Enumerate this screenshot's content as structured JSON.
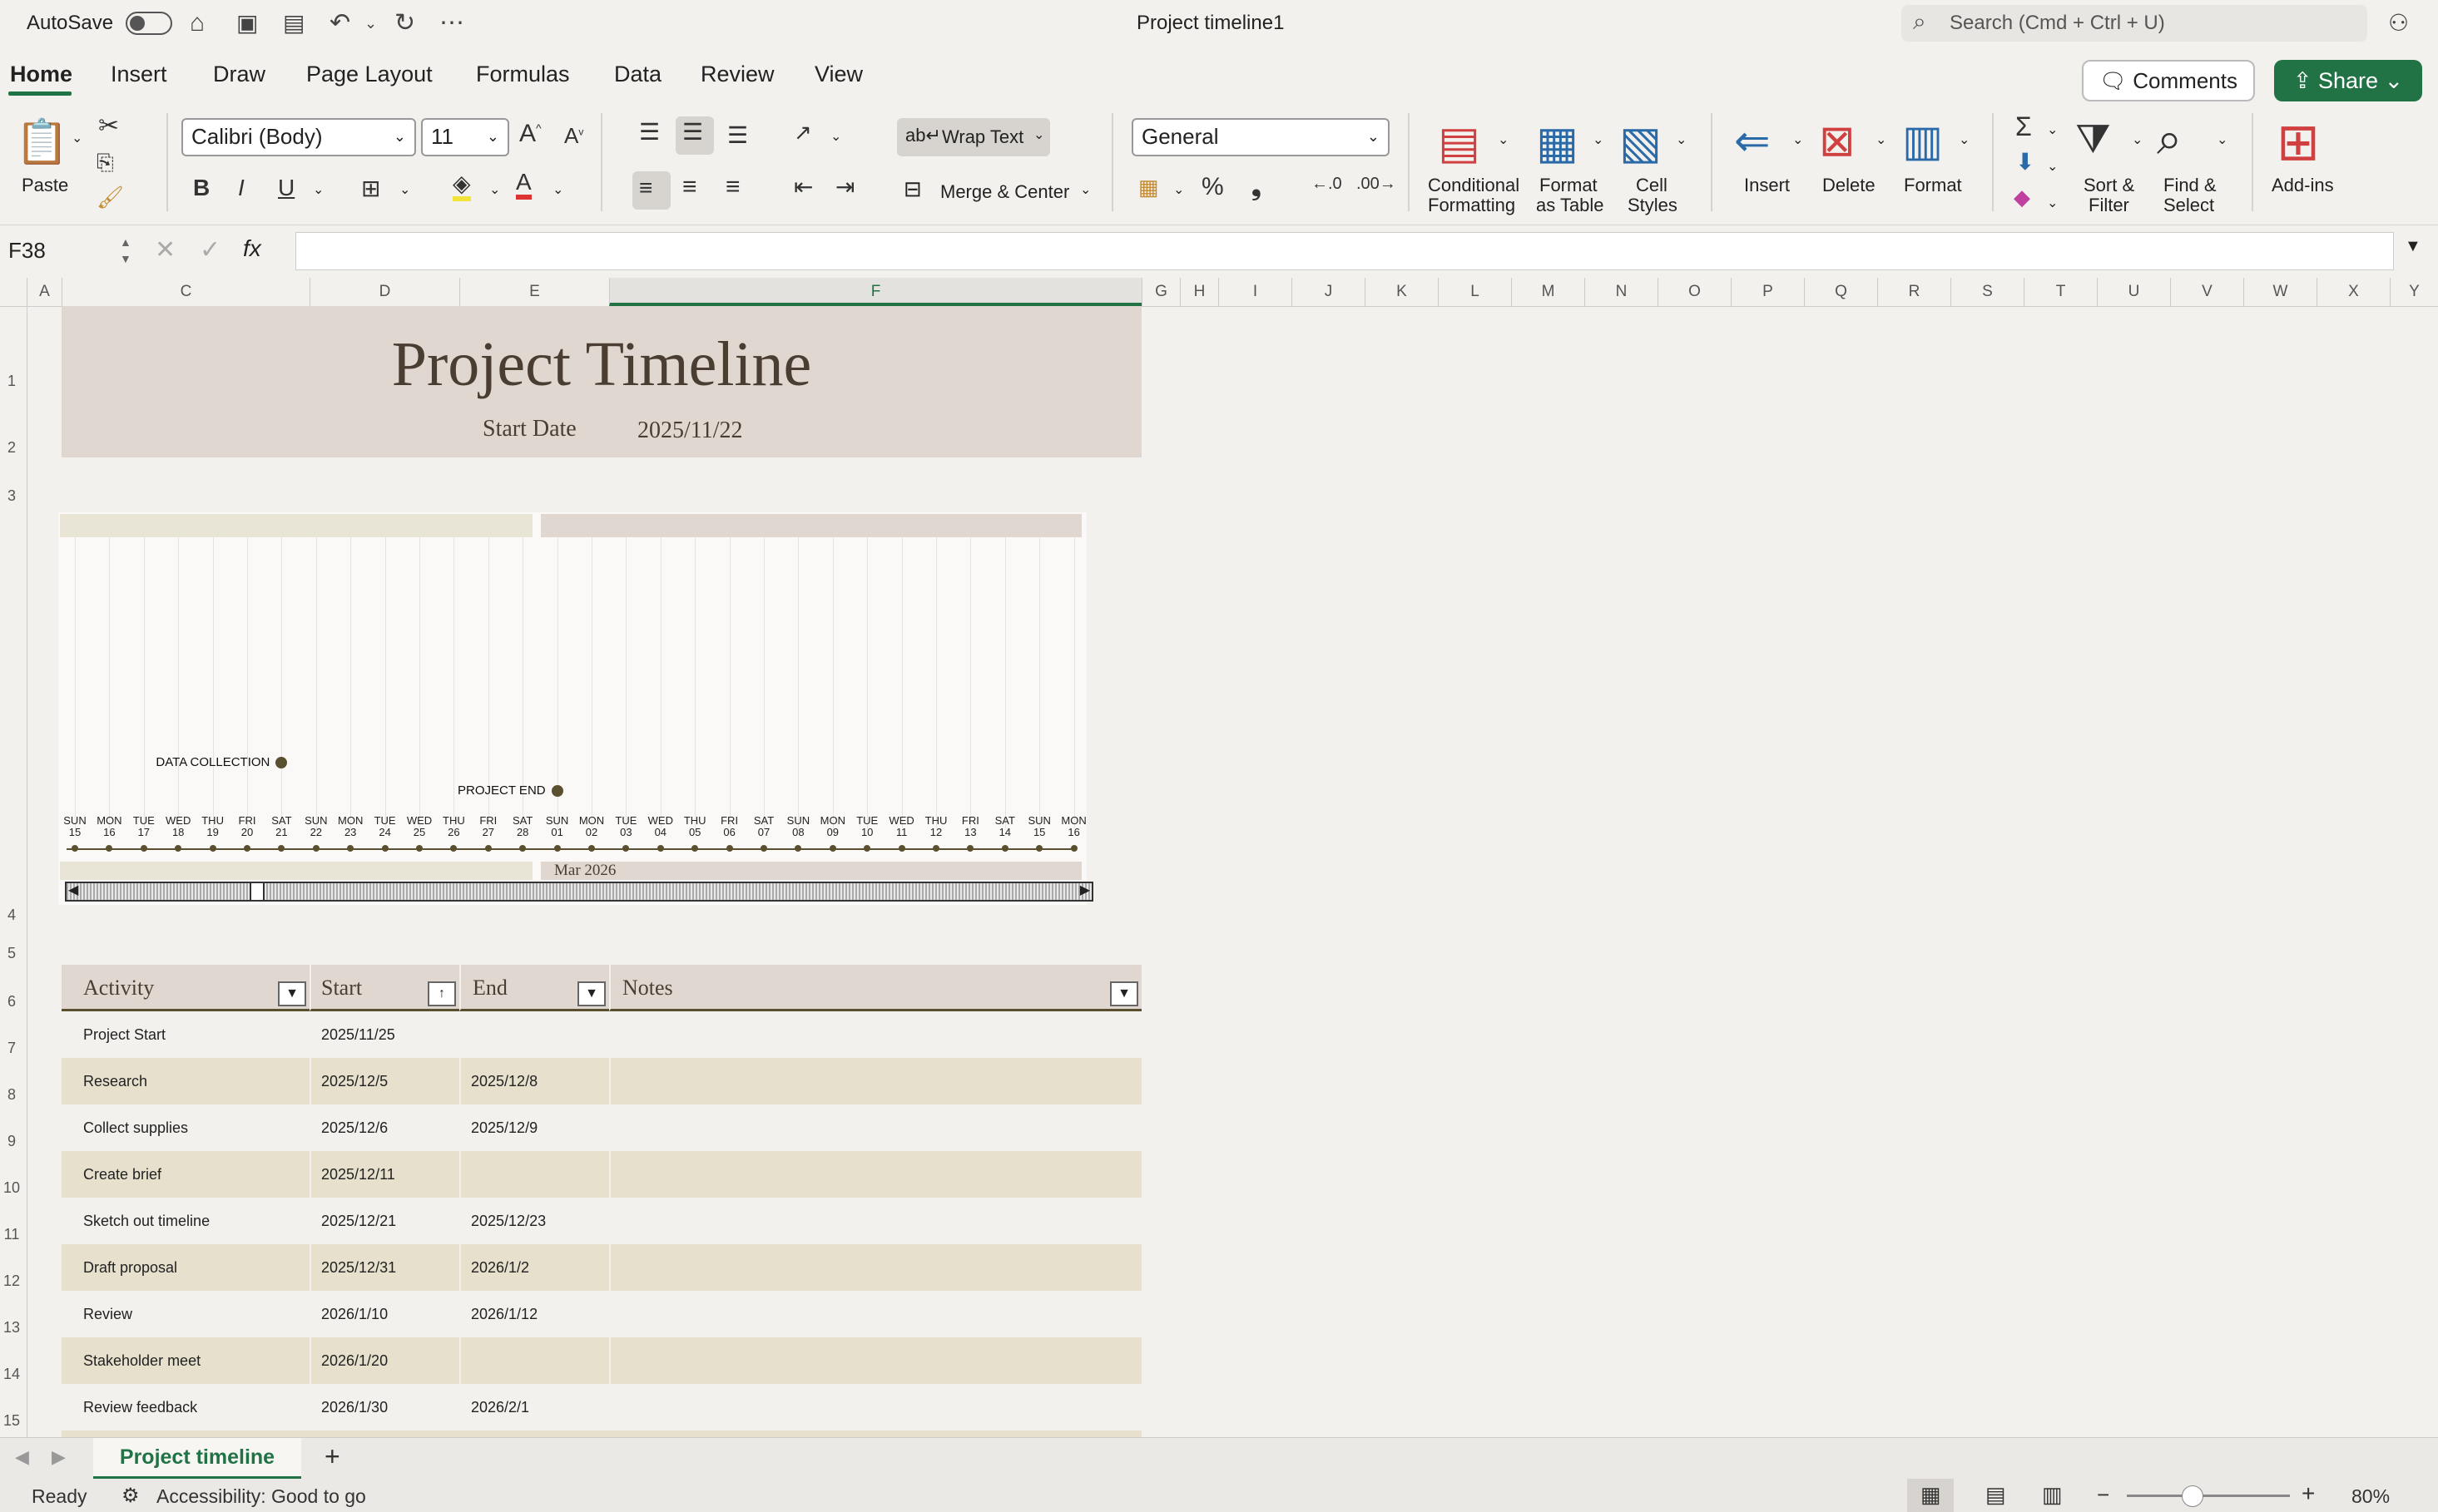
{
  "titlebar": {
    "autosave": "AutoSave",
    "doc_title": "Project timeline1",
    "search_placeholder": "Search (Cmd + Ctrl + U)"
  },
  "tabs": [
    "Home",
    "Insert",
    "Draw",
    "Page Layout",
    "Formulas",
    "Data",
    "Review",
    "View"
  ],
  "actions": {
    "comments": "Comments",
    "share": "Share"
  },
  "ribbon": {
    "paste": "Paste",
    "font_name": "Calibri (Body)",
    "font_size": "11",
    "bold": "B",
    "italic": "I",
    "underline": "U",
    "wrap_text": "Wrap Text",
    "merge_center": "Merge & Center",
    "number_format": "General",
    "conditional_formatting": [
      "Conditional",
      "Formatting"
    ],
    "format_as_table": [
      "Format",
      "as Table"
    ],
    "cell_styles": [
      "Cell",
      "Styles"
    ],
    "insert": "Insert",
    "delete": "Delete",
    "format": "Format",
    "sort_filter": [
      "Sort &",
      "Filter"
    ],
    "find_select": [
      "Find &",
      "Select"
    ],
    "add_ins": "Add-ins"
  },
  "formula_bar": {
    "name_box": "F38",
    "fx": "fx",
    "value": ""
  },
  "columns": [
    "A",
    "C",
    "D",
    "E",
    "F",
    "G",
    "H",
    "I",
    "J",
    "K",
    "L",
    "M",
    "N",
    "O",
    "P",
    "Q",
    "R",
    "S",
    "T",
    "U",
    "V",
    "W",
    "X",
    "Y"
  ],
  "rows": [
    "1",
    "2",
    "3",
    "4",
    "5",
    "6",
    "7",
    "8",
    "9",
    "10",
    "11",
    "12",
    "13",
    "14",
    "15"
  ],
  "sheet": {
    "title": "Project Timeline",
    "start_date_label": "Start Date",
    "start_date_value": "2025/11/22"
  },
  "timeline": {
    "days": [
      {
        "d": "SUN",
        "n": "15"
      },
      {
        "d": "MON",
        "n": "16"
      },
      {
        "d": "TUE",
        "n": "17"
      },
      {
        "d": "WED",
        "n": "18"
      },
      {
        "d": "THU",
        "n": "19"
      },
      {
        "d": "FRI",
        "n": "20"
      },
      {
        "d": "SAT",
        "n": "21"
      },
      {
        "d": "SUN",
        "n": "22"
      },
      {
        "d": "MON",
        "n": "23"
      },
      {
        "d": "TUE",
        "n": "24"
      },
      {
        "d": "WED",
        "n": "25"
      },
      {
        "d": "THU",
        "n": "26"
      },
      {
        "d": "FRI",
        "n": "27"
      },
      {
        "d": "SAT",
        "n": "28"
      },
      {
        "d": "SUN",
        "n": "01"
      },
      {
        "d": "MON",
        "n": "02"
      },
      {
        "d": "TUE",
        "n": "03"
      },
      {
        "d": "WED",
        "n": "04"
      },
      {
        "d": "THU",
        "n": "05"
      },
      {
        "d": "FRI",
        "n": "06"
      },
      {
        "d": "SAT",
        "n": "07"
      },
      {
        "d": "SUN",
        "n": "08"
      },
      {
        "d": "MON",
        "n": "09"
      },
      {
        "d": "TUE",
        "n": "10"
      },
      {
        "d": "WED",
        "n": "11"
      },
      {
        "d": "THU",
        "n": "12"
      },
      {
        "d": "FRI",
        "n": "13"
      },
      {
        "d": "SAT",
        "n": "14"
      },
      {
        "d": "SUN",
        "n": "15"
      },
      {
        "d": "MON",
        "n": "16"
      }
    ],
    "milestones": [
      {
        "label": "DATA COLLECTION",
        "day_index": 6,
        "level": 0
      },
      {
        "label": "PROJECT END",
        "day_index": 14,
        "level": 1
      }
    ],
    "month_label": "Mar 2026"
  },
  "table": {
    "headers": [
      "Activity",
      "Start",
      "End",
      "Notes"
    ],
    "rows": [
      [
        "Project Start",
        "2025/11/25",
        "",
        ""
      ],
      [
        "Research",
        "2025/12/5",
        "2025/12/8",
        ""
      ],
      [
        "Collect supplies",
        "2025/12/6",
        "2025/12/9",
        ""
      ],
      [
        "Create brief",
        "2025/12/11",
        "",
        ""
      ],
      [
        "Sketch out timeline",
        "2025/12/21",
        "2025/12/23",
        ""
      ],
      [
        "Draft proposal",
        "2025/12/31",
        "2026/1/2",
        ""
      ],
      [
        "Review",
        "2026/1/10",
        "2026/1/12",
        ""
      ],
      [
        "Stakeholder meet",
        "2026/1/20",
        "",
        ""
      ],
      [
        "Review feedback",
        "2026/1/30",
        "2026/2/1",
        ""
      ]
    ]
  },
  "sheet_tabs": {
    "active": "Project timeline",
    "add": "+"
  },
  "status": {
    "ready": "Ready",
    "accessibility": "Accessibility: Good to go",
    "zoom": "80%"
  },
  "colors": {
    "accent": "#217346",
    "banner": "#e0d7d0",
    "band": "#e6e0cc",
    "dot": "#5a5030"
  }
}
